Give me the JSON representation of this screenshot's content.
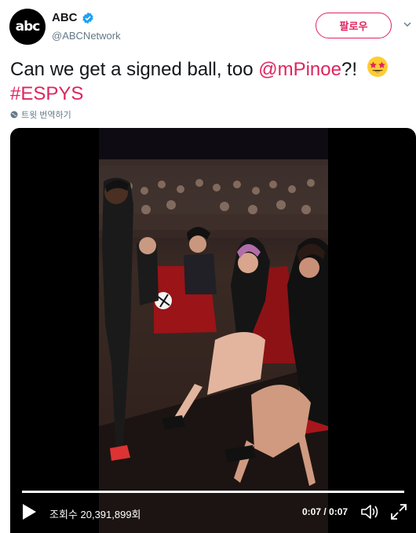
{
  "account": {
    "avatar_text": "abc",
    "display_name": "ABC",
    "handle": "@ABCNetwork",
    "follow_label": "팔로우"
  },
  "tweet": {
    "text_before": "Can we get a signed ball, too ",
    "mention": "@mPinoe",
    "text_after": "?!",
    "hashtag": "#ESPYS",
    "emoji": "star-struck-emoji"
  },
  "translate_label": "트윗 번역하기",
  "video": {
    "views_label": "조회수 20,391,899회",
    "time_label": "0:07 / 0:07",
    "progress": 1.0
  },
  "colors": {
    "accent": "#e0245e",
    "verified": "#1da1f2",
    "muted": "#657786"
  }
}
